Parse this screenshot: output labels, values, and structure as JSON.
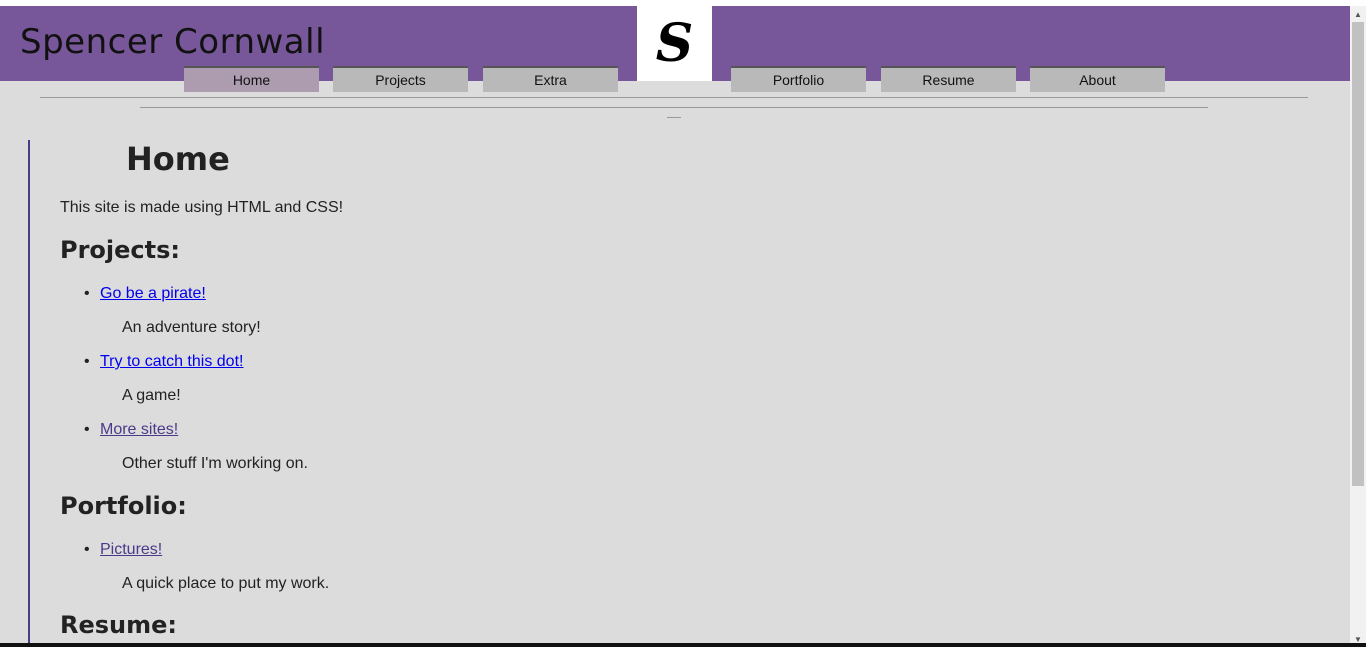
{
  "header": {
    "site_title": "Spencer Cornwall",
    "logo_letter": "S",
    "nav": [
      {
        "label": "Home",
        "active": true
      },
      {
        "label": "Projects",
        "active": false
      },
      {
        "label": "Extra",
        "active": false
      },
      {
        "label": "Portfolio",
        "active": false
      },
      {
        "label": "Resume",
        "active": false
      },
      {
        "label": "About",
        "active": false
      }
    ]
  },
  "main": {
    "title": "Home",
    "intro": "This site is made using HTML and CSS!",
    "projects_heading": "Projects:",
    "projects": [
      {
        "link": "Go be a pirate!",
        "desc": "An adventure story!"
      },
      {
        "link": "Try to catch this dot!",
        "desc": "A game!"
      },
      {
        "link": "More sites!",
        "desc": "Other stuff I'm working on."
      }
    ],
    "portfolio_heading": "Portfolio:",
    "portfolio": [
      {
        "link": "Pictures!",
        "desc": "A quick place to put my work."
      }
    ],
    "resume_heading": "Resume:"
  },
  "colors": {
    "header_bg": "#77579a",
    "page_bg": "#dcdcdc",
    "tab_bg": "#b9b9b9",
    "tab_active_bg": "#ad9cb0",
    "link": "#0000ee",
    "link_visited": "#4b3a8a"
  },
  "icons": {
    "bullet": "•",
    "scroll_up": "▲",
    "scroll_down": "▼"
  }
}
